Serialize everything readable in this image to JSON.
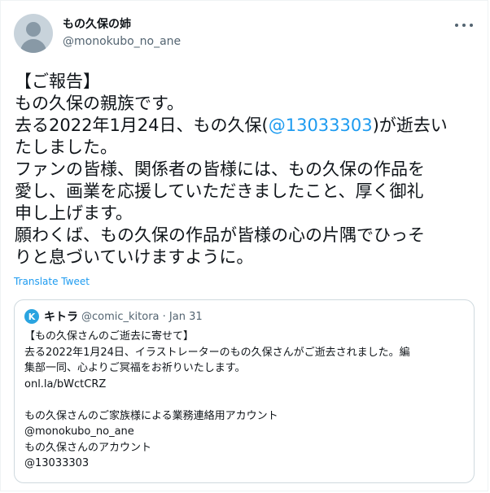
{
  "tweet": {
    "display_name": "もの久保の姉",
    "handle": "@monokubo_no_ane",
    "more_icon": "more-horizontal-icon",
    "body": {
      "line1": "【ご報告】",
      "line2": "もの久保の親族です。",
      "line3_before": "去る2022年1月24日、もの久保(",
      "line3_mention": "@13033303",
      "line3_after": ")が逝去い",
      "line4": "たしました。",
      "line5": "ファンの皆様、関係者の皆様には、もの久保の作品を",
      "line6": "愛し、画業を応援していただきましたこと、厚く御礼",
      "line7": "申し上げます。",
      "line8": "願わくば、もの久保の作品が皆様の心の片隅でひっそ",
      "line9": "りと息づいていけますように。"
    },
    "translate_label": "Translate Tweet"
  },
  "quote": {
    "avatar_letter": "K",
    "name": "キトラ",
    "meta": "@comic_kitora · Jan 31",
    "lines": [
      "【もの久保さんのご逝去に寄せて】",
      "去る2022年1月24日、イラストレーターのもの久保さんがご逝去されました。編",
      "集部一同、心よりご冥福をお祈りいたします。",
      "onl.la/bWctCRZ",
      "",
      "もの久保さんのご家族様による業務連絡用アカウント",
      "@monokubo_no_ane",
      "もの久保さんのアカウント",
      "@13033303"
    ]
  },
  "colors": {
    "link": "#1d9bf0",
    "secondary_text": "#536471",
    "border": "#cfd9de"
  }
}
